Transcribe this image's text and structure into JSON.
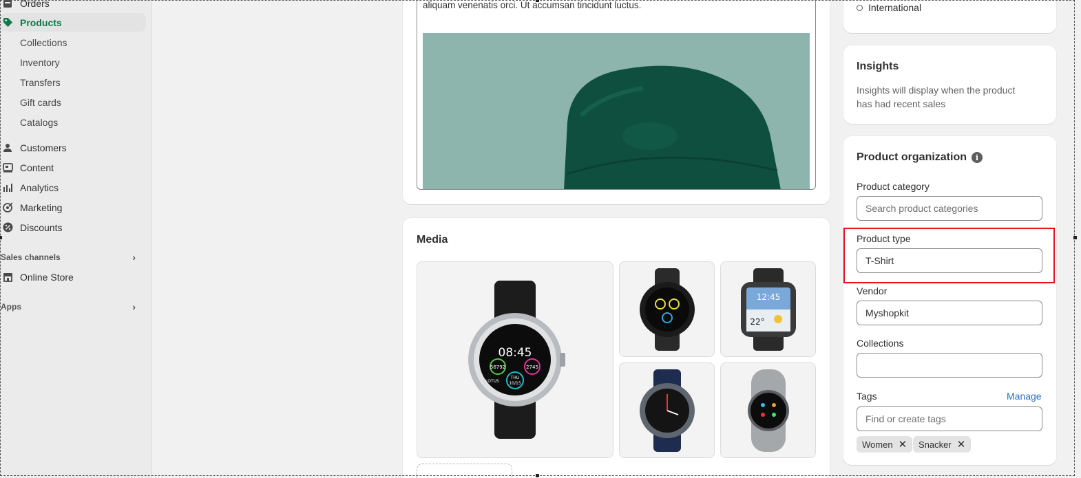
{
  "sidebar": {
    "orders_label": "Orders",
    "products_label": "Products",
    "sub_items": [
      "Collections",
      "Inventory",
      "Transfers",
      "Gift cards",
      "Catalogs"
    ],
    "customers_label": "Customers",
    "content_label": "Content",
    "analytics_label": "Analytics",
    "marketing_label": "Marketing",
    "discounts_label": "Discounts",
    "sales_channels_label": "Sales channels",
    "online_store_label": "Online Store",
    "apps_label": "Apps"
  },
  "description": {
    "text": "aliquam venenatis orci. Ut accumsan tincidunt luctus."
  },
  "media": {
    "title": "Media",
    "watch_main": {
      "time": "08:45",
      "steps": "56792",
      "kcal": "2745",
      "day": "THU",
      "date": "10/15",
      "brand": "LOTUS"
    },
    "watch_gear_time": "12:45",
    "watch_gear_temp": "22°"
  },
  "markets": {
    "international_label": "International"
  },
  "insights": {
    "title": "Insights",
    "body": "Insights will display when the product has had recent sales"
  },
  "organization": {
    "title": "Product organization",
    "info_glyph": "i",
    "category_label": "Product category",
    "category_placeholder": "Search product categories",
    "type_label": "Product type",
    "type_value": "T-Shirt",
    "vendor_label": "Vendor",
    "vendor_value": "Myshopkit",
    "collections_label": "Collections",
    "collections_value": "",
    "tags_label": "Tags",
    "manage_label": "Manage",
    "tags_placeholder": "Find or create tags",
    "tags": [
      "Women",
      "Snacker"
    ],
    "remove_glyph": "✕"
  },
  "colors": {
    "accent_green": "#0f7a49",
    "link_blue": "#2c6ecb",
    "highlight_red": "#e8111c"
  }
}
